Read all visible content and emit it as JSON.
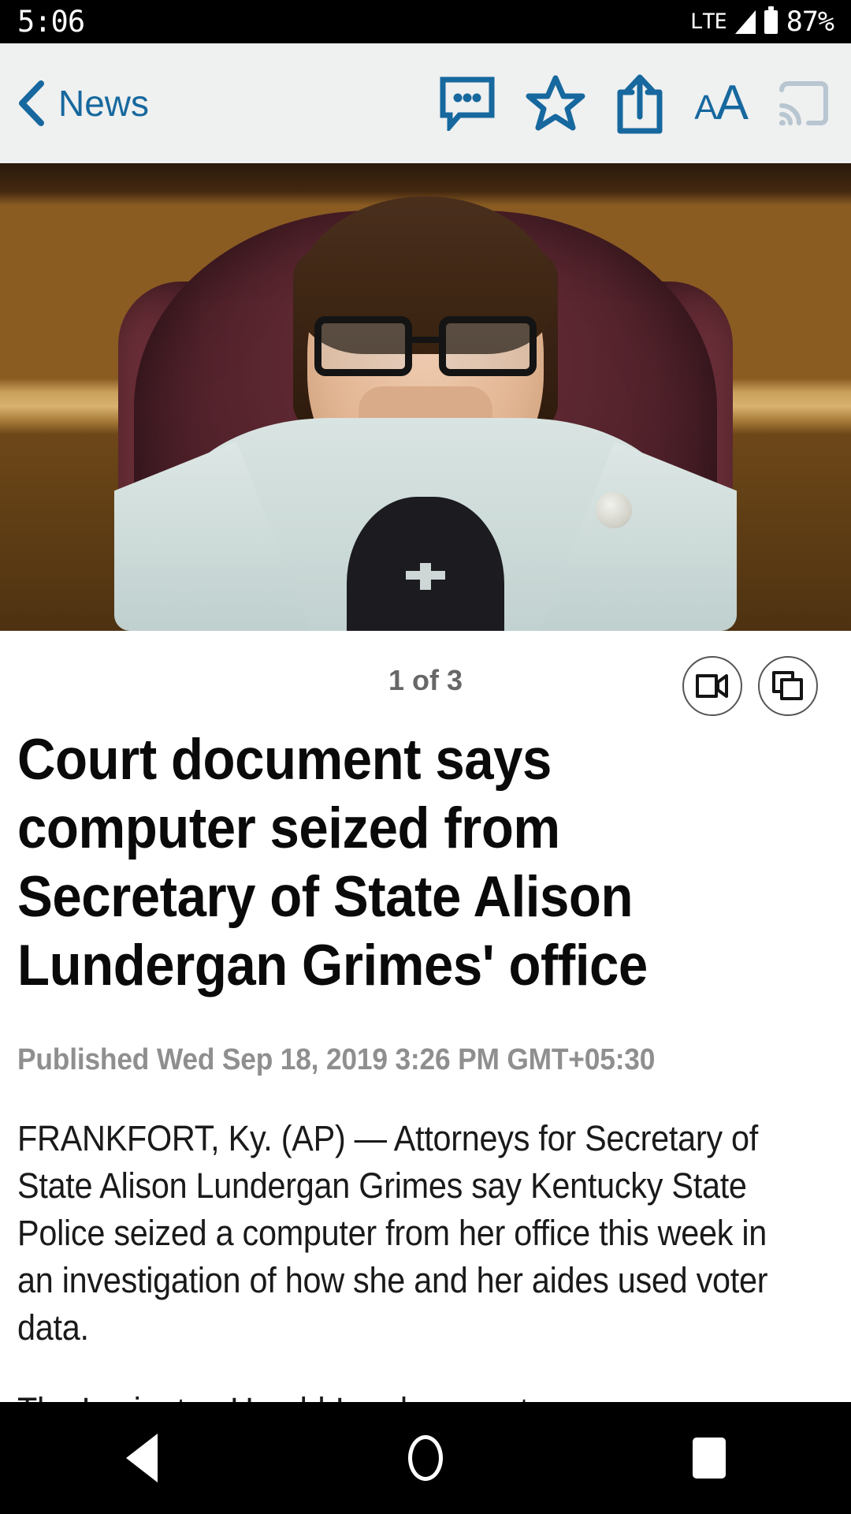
{
  "status_bar": {
    "clock": "5:06",
    "network": "LTE",
    "battery_percent": "87%",
    "icons": {
      "signal": "signal-triangle-icon",
      "battery": "battery-icon"
    }
  },
  "nav_bar": {
    "back_label": "News",
    "accent_color": "#16689e",
    "disabled_color": "#b7c6d0",
    "background": "#eff0f0",
    "icons": [
      {
        "name": "comment-icon",
        "label": "Comments",
        "enabled": true
      },
      {
        "name": "star-icon",
        "label": "Save",
        "enabled": true
      },
      {
        "name": "share-icon",
        "label": "Share",
        "enabled": true
      },
      {
        "name": "text-size-icon",
        "label": "AA",
        "aa_small": "A",
        "aa_big": "A",
        "enabled": true
      },
      {
        "name": "cast-icon",
        "label": "Cast",
        "enabled": false
      }
    ]
  },
  "hero": {
    "alt": "Woman with glasses seated in a dark burgundy leather chair in front of a wood-paneled wall"
  },
  "gallery": {
    "counter": "1 of 3",
    "counter_color": "#676767",
    "video_button": "video-camera-icon",
    "gallery_button": "stacked-photos-icon"
  },
  "article": {
    "headline": "Court document says computer seized from Secretary of State Alison Lundergan Grimes' office",
    "byline": "Published Wed Sep 18, 2019 3:26 PM GMT+05:30",
    "byline_color": "#8f8f8f",
    "paragraphs": [
      "FRANKFORT, Ky. (AP) — Attorneys for Secretary of State Alison Lundergan Grimes say Kentucky State Police seized a computer from her office this week in an investigation of how she and her aides used voter data.",
      "The Lexington Herald-Leader reports"
    ],
    "link_color": "#1a73c8"
  },
  "android_nav": {
    "back": "back-triangle-icon",
    "home": "home-circle-icon",
    "recents": "recents-square-icon",
    "background": "#000000"
  }
}
